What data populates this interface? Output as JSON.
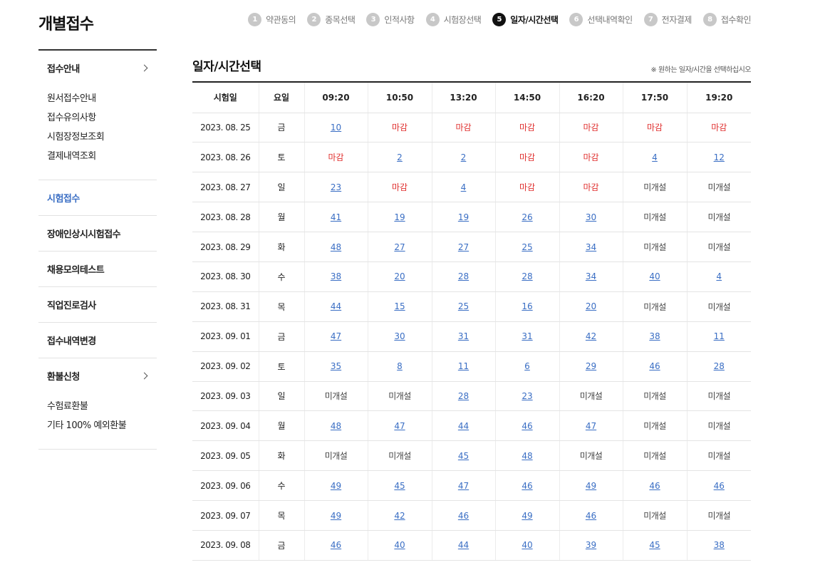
{
  "page_title": "개별접수",
  "steps": [
    {
      "num": "1",
      "label": "약관동의"
    },
    {
      "num": "2",
      "label": "종목선택"
    },
    {
      "num": "3",
      "label": "인적사항"
    },
    {
      "num": "4",
      "label": "시험장선택"
    },
    {
      "num": "5",
      "label": "일자/시간선택"
    },
    {
      "num": "6",
      "label": "선택내역확인"
    },
    {
      "num": "7",
      "label": "전자결제"
    },
    {
      "num": "8",
      "label": "접수확인"
    }
  ],
  "active_step": 4,
  "sidebar": {
    "groups": [
      {
        "label": "접수안내",
        "chevron": true,
        "subs": [
          "원서접수안내",
          "접수유의사항",
          "시험장정보조회",
          "결제내역조회"
        ]
      },
      {
        "label": "시험접수",
        "active": true
      },
      {
        "label": "장애인상시시험접수"
      },
      {
        "label": "채용모의테스트"
      },
      {
        "label": "직업진로검사"
      },
      {
        "label": "접수내역변경"
      },
      {
        "label": "환불신청",
        "chevron": true,
        "subs": [
          "수험료환불",
          "기타 100% 예외환불"
        ]
      }
    ]
  },
  "main": {
    "title": "일자/시간선택",
    "note": "※ 원하는 일자/시간을 선택하십시오",
    "columns": [
      "시험일",
      "요일",
      "09:20",
      "10:50",
      "13:20",
      "14:50",
      "16:20",
      "17:50",
      "19:20"
    ],
    "rows": [
      {
        "date": "2023. 08. 25",
        "day": "금",
        "slots": [
          "10",
          "마감",
          "마감",
          "마감",
          "마감",
          "마감",
          "마감"
        ]
      },
      {
        "date": "2023. 08. 26",
        "day": "토",
        "slots": [
          "마감",
          "2",
          "2",
          "마감",
          "마감",
          "4",
          "12"
        ]
      },
      {
        "date": "2023. 08. 27",
        "day": "일",
        "slots": [
          "23",
          "마감",
          "4",
          "마감",
          "마감",
          "미개설",
          "미개설"
        ]
      },
      {
        "date": "2023. 08. 28",
        "day": "월",
        "slots": [
          "41",
          "19",
          "19",
          "26",
          "30",
          "미개설",
          "미개설"
        ]
      },
      {
        "date": "2023. 08. 29",
        "day": "화",
        "slots": [
          "48",
          "27",
          "27",
          "25",
          "34",
          "미개설",
          "미개설"
        ]
      },
      {
        "date": "2023. 08. 30",
        "day": "수",
        "slots": [
          "38",
          "20",
          "28",
          "28",
          "34",
          "40",
          "4"
        ]
      },
      {
        "date": "2023. 08. 31",
        "day": "목",
        "slots": [
          "44",
          "15",
          "25",
          "16",
          "20",
          "미개설",
          "미개설"
        ]
      },
      {
        "date": "2023. 09. 01",
        "day": "금",
        "slots": [
          "47",
          "30",
          "31",
          "31",
          "42",
          "38",
          "11"
        ]
      },
      {
        "date": "2023. 09. 02",
        "day": "토",
        "slots": [
          "35",
          "8",
          "11",
          "6",
          "29",
          "46",
          "28"
        ]
      },
      {
        "date": "2023. 09. 03",
        "day": "일",
        "slots": [
          "미개설",
          "미개설",
          "28",
          "23",
          "미개설",
          "미개설",
          "미개설"
        ]
      },
      {
        "date": "2023. 09. 04",
        "day": "월",
        "slots": [
          "48",
          "47",
          "44",
          "46",
          "47",
          "미개설",
          "미개설"
        ]
      },
      {
        "date": "2023. 09. 05",
        "day": "화",
        "slots": [
          "미개설",
          "미개설",
          "45",
          "48",
          "미개설",
          "미개설",
          "미개설"
        ]
      },
      {
        "date": "2023. 09. 06",
        "day": "수",
        "slots": [
          "49",
          "45",
          "47",
          "46",
          "49",
          "46",
          "46"
        ]
      },
      {
        "date": "2023. 09. 07",
        "day": "목",
        "slots": [
          "49",
          "42",
          "46",
          "49",
          "46",
          "미개설",
          "미개설"
        ]
      },
      {
        "date": "2023. 09. 08",
        "day": "금",
        "slots": [
          "46",
          "40",
          "44",
          "40",
          "39",
          "45",
          "38"
        ]
      }
    ]
  },
  "colors": {
    "accent": "#3a6ec4",
    "closed": "#e0302f",
    "active_step": "#111111",
    "inactive_step": "#c8c8c8"
  }
}
